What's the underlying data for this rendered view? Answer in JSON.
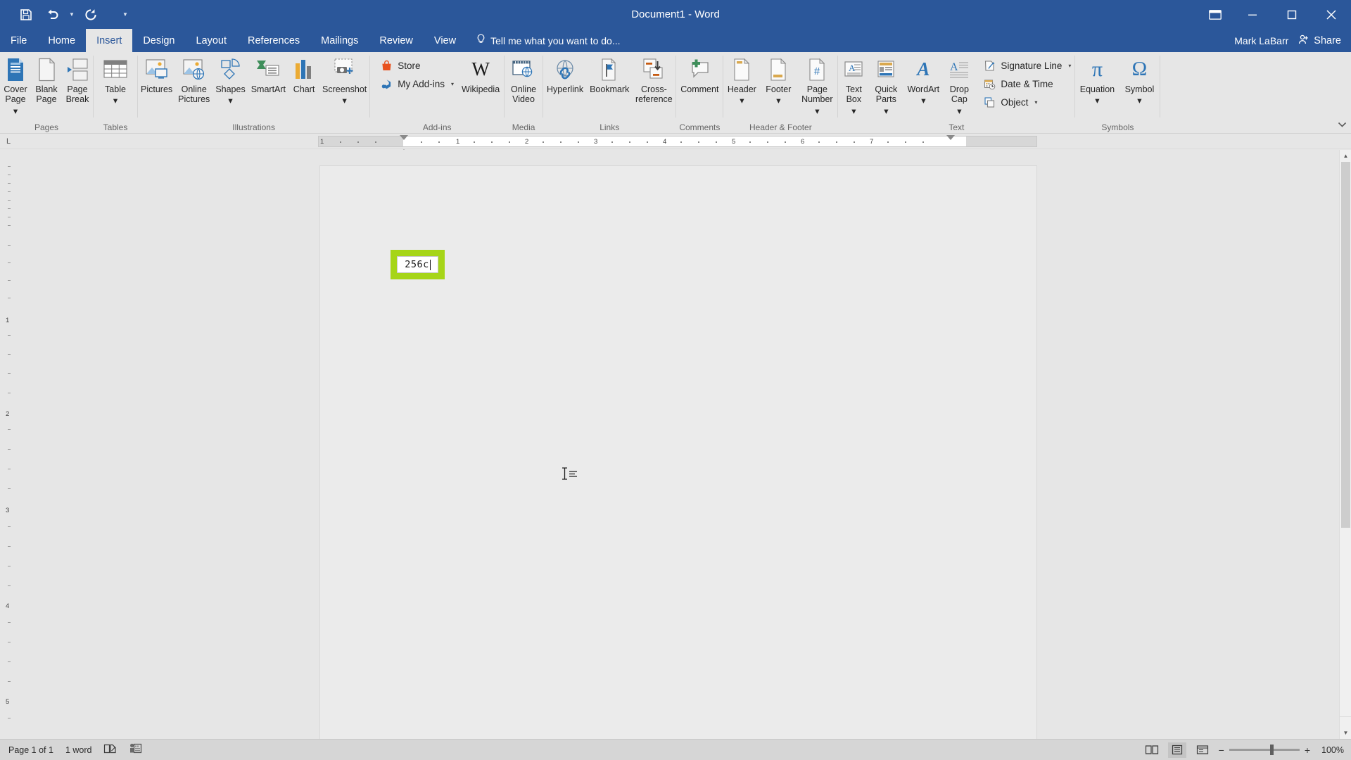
{
  "titlebar": {
    "document_title": "Document1 - Word",
    "qat": [
      {
        "name": "save-icon",
        "label": "Save"
      },
      {
        "name": "undo-icon",
        "label": "Undo"
      },
      {
        "name": "redo-icon",
        "label": "Repeat Typing"
      },
      {
        "name": "customize-qat-icon",
        "label": "Customize Quick Access Toolbar"
      }
    ],
    "window_controls": {
      "ribbon_display": "Ribbon Display Options",
      "minimize": "Minimize",
      "restore": "Restore Down",
      "close": "Close"
    }
  },
  "tabs": [
    {
      "label": "File",
      "active": false
    },
    {
      "label": "Home",
      "active": false
    },
    {
      "label": "Insert",
      "active": true
    },
    {
      "label": "Design",
      "active": false
    },
    {
      "label": "Layout",
      "active": false
    },
    {
      "label": "References",
      "active": false
    },
    {
      "label": "Mailings",
      "active": false
    },
    {
      "label": "Review",
      "active": false
    },
    {
      "label": "View",
      "active": false
    }
  ],
  "tellme": {
    "placeholder": "Tell me what you want to do...",
    "icon": "lightbulb-icon"
  },
  "account": {
    "user_name": "Mark LaBarr",
    "share_label": "Share",
    "share_icon": "share-person-icon"
  },
  "ribbon": {
    "groups": [
      {
        "label": "Pages",
        "items": [
          {
            "label": "Cover\nPage",
            "icon": "cover-page-icon",
            "dropdown": true
          },
          {
            "label": "Blank\nPage",
            "icon": "blank-page-icon",
            "dropdown": false
          },
          {
            "label": "Page\nBreak",
            "icon": "page-break-icon",
            "dropdown": false
          }
        ]
      },
      {
        "label": "Tables",
        "items": [
          {
            "label": "Table",
            "icon": "table-icon",
            "dropdown": true
          }
        ]
      },
      {
        "label": "Illustrations",
        "items": [
          {
            "label": "Pictures",
            "icon": "pictures-icon",
            "dropdown": false
          },
          {
            "label": "Online\nPictures",
            "icon": "online-pictures-icon",
            "dropdown": false
          },
          {
            "label": "Shapes",
            "icon": "shapes-icon",
            "dropdown": true
          },
          {
            "label": "SmartArt",
            "icon": "smartart-icon",
            "dropdown": false
          },
          {
            "label": "Chart",
            "icon": "chart-icon",
            "dropdown": false
          },
          {
            "label": "Screenshot",
            "icon": "screenshot-icon",
            "dropdown": true
          }
        ]
      },
      {
        "label": "Add-ins",
        "items": [
          {
            "label": "Store",
            "icon": "store-icon",
            "dropdown": false
          },
          {
            "label": "My Add-ins",
            "icon": "my-addins-icon",
            "dropdown": true
          },
          {
            "label": "Wikipedia",
            "icon": "wikipedia-icon",
            "dropdown": false
          }
        ]
      },
      {
        "label": "Media",
        "items": [
          {
            "label": "Online\nVideo",
            "icon": "online-video-icon",
            "dropdown": false
          }
        ]
      },
      {
        "label": "Links",
        "items": [
          {
            "label": "Hyperlink",
            "icon": "hyperlink-icon",
            "dropdown": false
          },
          {
            "label": "Bookmark",
            "icon": "bookmark-icon",
            "dropdown": false
          },
          {
            "label": "Cross-\nreference",
            "icon": "cross-reference-icon",
            "dropdown": false
          }
        ]
      },
      {
        "label": "Comments",
        "items": [
          {
            "label": "Comment",
            "icon": "comment-icon",
            "dropdown": false
          }
        ]
      },
      {
        "label": "Header & Footer",
        "items": [
          {
            "label": "Header",
            "icon": "header-icon",
            "dropdown": true
          },
          {
            "label": "Footer",
            "icon": "footer-icon",
            "dropdown": true
          },
          {
            "label": "Page\nNumber",
            "icon": "page-number-icon",
            "dropdown": true
          }
        ]
      },
      {
        "label": "Text",
        "items": [
          {
            "label": "Text\nBox",
            "icon": "text-box-icon",
            "dropdown": true
          },
          {
            "label": "Quick\nParts",
            "icon": "quick-parts-icon",
            "dropdown": true
          },
          {
            "label": "WordArt",
            "icon": "wordart-icon",
            "dropdown": true
          },
          {
            "label": "Drop\nCap",
            "icon": "drop-cap-icon",
            "dropdown": true
          },
          {
            "label": "Signature Line",
            "icon": "signature-line-icon",
            "dropdown": true
          },
          {
            "label": "Date & Time",
            "icon": "date-time-icon",
            "dropdown": false
          },
          {
            "label": "Object",
            "icon": "object-icon",
            "dropdown": true
          }
        ]
      },
      {
        "label": "Symbols",
        "items": [
          {
            "label": "Equation",
            "icon": "equation-icon",
            "dropdown": true
          },
          {
            "label": "Symbol",
            "icon": "symbol-icon",
            "dropdown": true
          }
        ]
      }
    ]
  },
  "ruler": {
    "corner_marker": "L",
    "h_ticks": [
      "1",
      "1",
      "2",
      "3",
      "4",
      "5",
      "6",
      "7"
    ]
  },
  "document": {
    "textbox_value": "256c",
    "textbox_highlight_color": "#a6d518",
    "cursor_icon": "i-beam-text-cursor"
  },
  "statusbar": {
    "page_status": "Page 1 of 1",
    "word_count": "1 word",
    "proofing_icon": "proofing-errors-icon",
    "accessibility_icon": "accessibility-checker-icon",
    "views": [
      {
        "name": "read-mode-icon",
        "label": "Read Mode",
        "selected": false
      },
      {
        "name": "print-layout-icon",
        "label": "Print Layout",
        "selected": true
      },
      {
        "name": "web-layout-icon",
        "label": "Web Layout",
        "selected": false
      }
    ],
    "zoom_out": "−",
    "zoom_in": "+",
    "zoom_level": "100%"
  },
  "colors": {
    "accent": "#2b579a",
    "ribbon_bg": "#e6e6e6",
    "highlight_green": "#a6d518"
  }
}
